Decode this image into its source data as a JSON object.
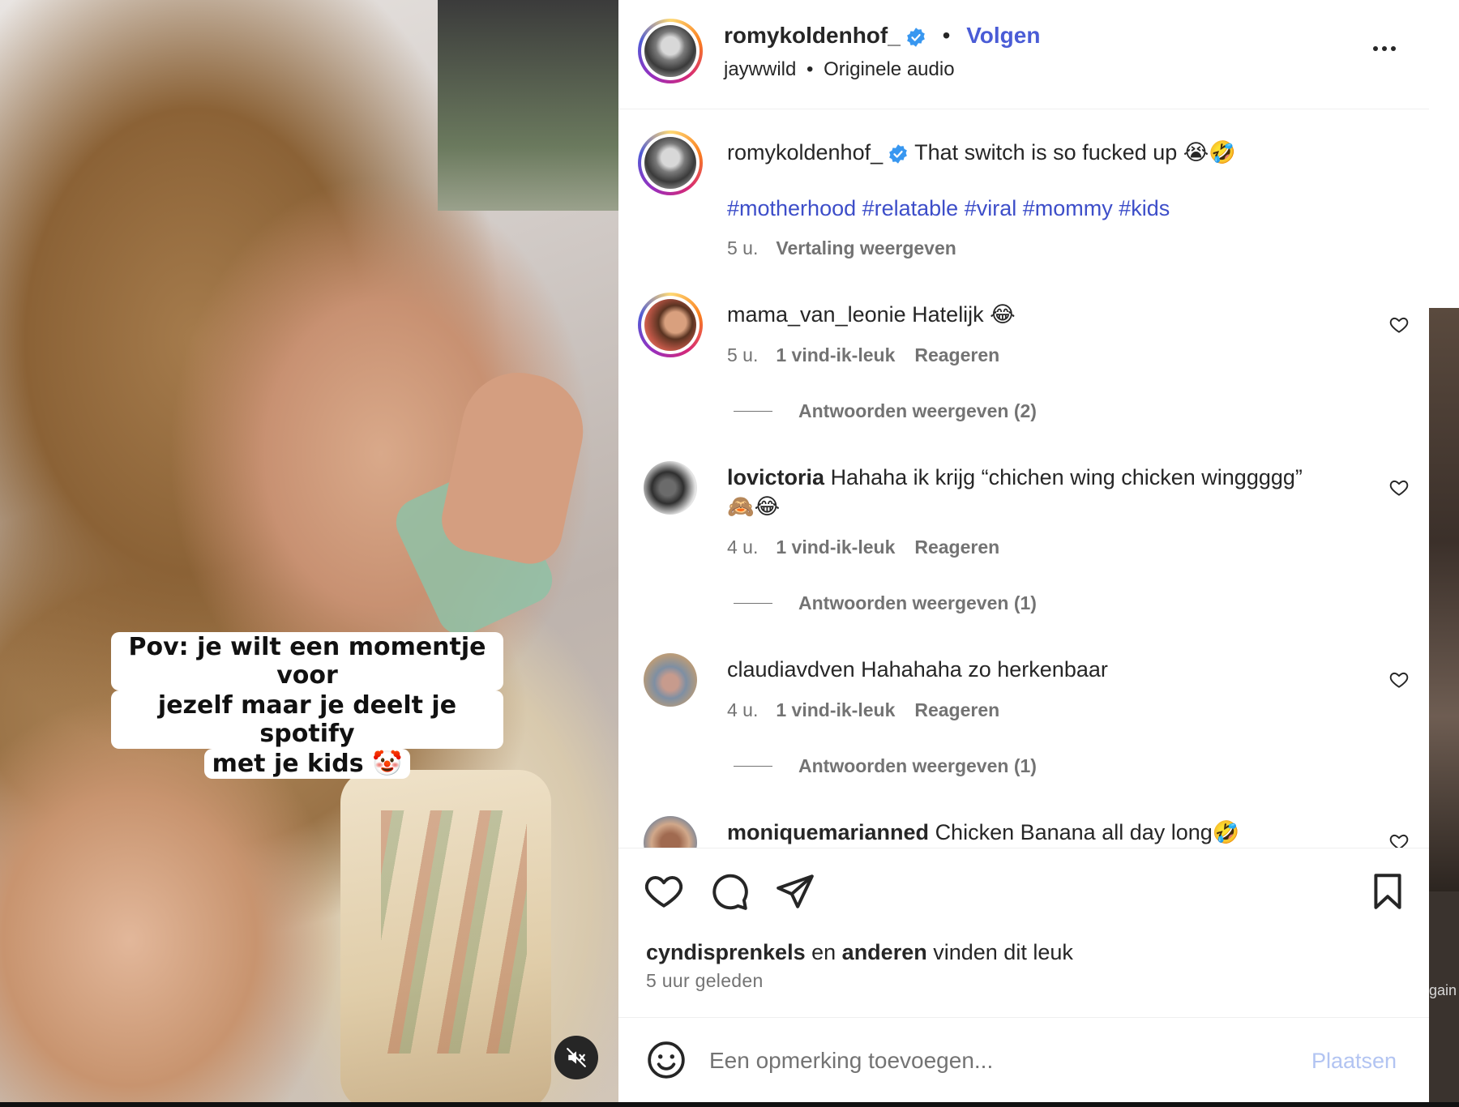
{
  "video": {
    "caption_lines": [
      "Pov: je wilt een momentje voor",
      "jezelf maar je deelt je spotify",
      "met je kids 🤡"
    ],
    "mute_icon": "muted-speaker-icon"
  },
  "header": {
    "username": "romykoldenhof_",
    "separator": "•",
    "follow_label": "Volgen",
    "audio_artist": "jaywwild",
    "audio_sep": "•",
    "audio_label": "Originele audio"
  },
  "post": {
    "username": "romykoldenhof_",
    "text": "That switch is so fucked up 😭🤣",
    "hashtags": "#motherhood #relatable #viral #mommy #kids",
    "time": "5 u.",
    "translate": "Vertaling weergeven"
  },
  "comments": [
    {
      "username": "mama_van_leonie",
      "text": "Hatelijk 😂",
      "time": "5 u.",
      "likes": "1 vind-ik-leuk",
      "reply": "Reageren",
      "view_replies": "Antwoorden weergeven (2)"
    },
    {
      "username": "lovictoria",
      "text": "Hahaha ik krijg “chichen wing chicken winggggg”",
      "text2": "🙈😂",
      "time": "4 u.",
      "likes": "1 vind-ik-leuk",
      "reply": "Reageren",
      "view_replies": "Antwoorden weergeven (1)"
    },
    {
      "username": "claudiavdven",
      "text": "Hahahaha zo herkenbaar",
      "time": "4 u.",
      "likes": "1 vind-ik-leuk",
      "reply": "Reageren",
      "view_replies": "Antwoorden weergeven (1)"
    },
    {
      "username": "moniquemarianned",
      "text": "Chicken Banana all day long🤣"
    }
  ],
  "actions": {
    "liked_by_user": "cyndisprenkels",
    "liked_by_mid": "en",
    "liked_by_others": "anderen",
    "liked_by_suffix": "vinden dit leuk",
    "time_ago": "5 uur geleden"
  },
  "composer": {
    "placeholder": "Een opmerking toevoegen...",
    "post_label": "Plaatsen"
  },
  "background": {
    "partial_text": "gain"
  },
  "colors": {
    "link_blue": "#4a5cd6",
    "hashtag_blue": "#3d4ec9",
    "post_disabled": "#b2c4f2",
    "verified": "#3897f0"
  }
}
